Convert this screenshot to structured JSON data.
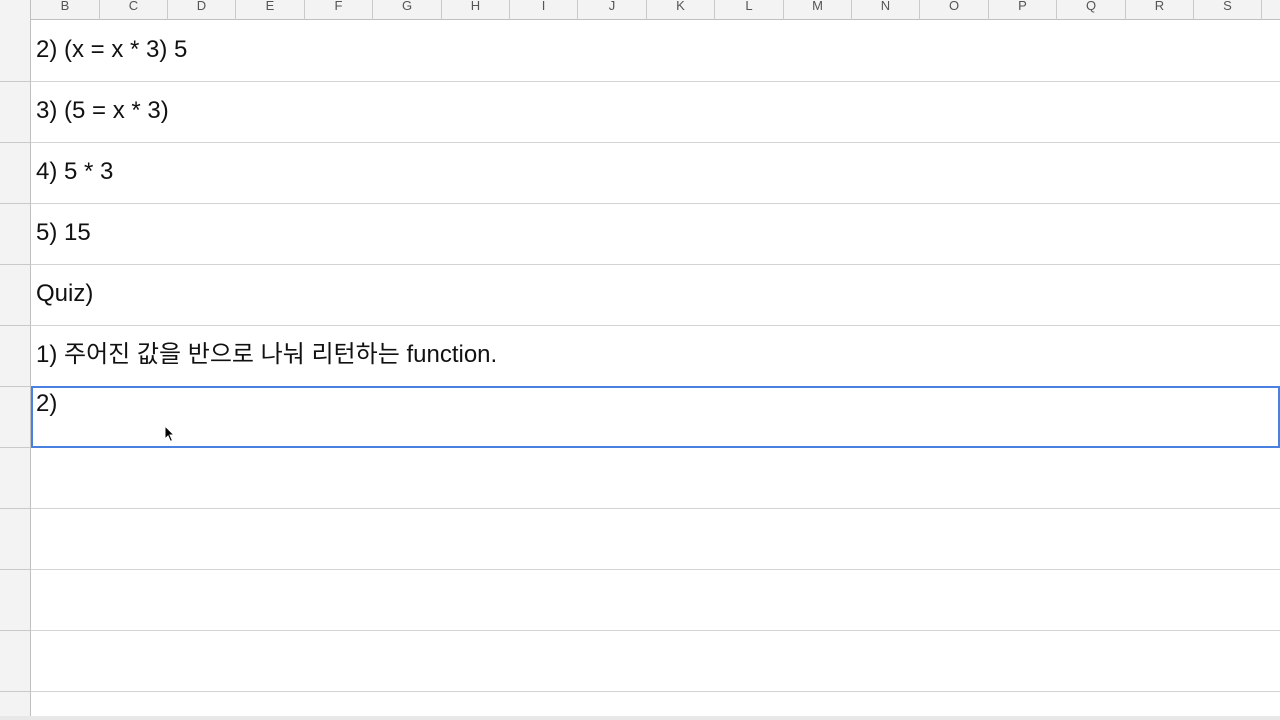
{
  "columns": [
    "B",
    "C",
    "D",
    "E",
    "F",
    "G",
    "H",
    "I",
    "J",
    "K",
    "L",
    "M",
    "N",
    "O",
    "P",
    "Q",
    "R",
    "S"
  ],
  "rows": [
    {
      "text": "2) (x = x * 3) 5"
    },
    {
      "text": "3) (5 = x * 3)"
    },
    {
      "text": "4) 5 * 3"
    },
    {
      "text": "5) 15"
    },
    {
      "text": "Quiz)"
    },
    {
      "text": "1) 주어진 값을 반으로 나눠 리턴하는 function."
    },
    {
      "text": "2)"
    },
    {
      "text": ""
    },
    {
      "text": ""
    },
    {
      "text": ""
    },
    {
      "text": ""
    }
  ],
  "selected_row_index": 6,
  "colors": {
    "selection_border": "#4a80e0",
    "header_bg": "#f3f3f3",
    "grid_line": "#d4d4d4"
  },
  "icons": {
    "cursor": "mouse-pointer-icon"
  }
}
